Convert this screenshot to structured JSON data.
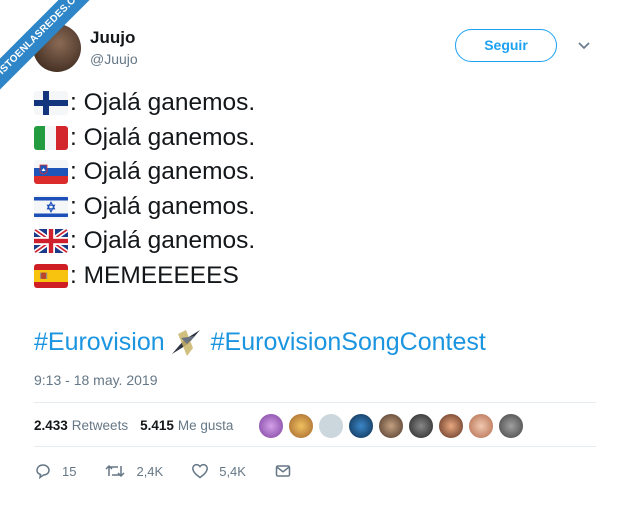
{
  "watermark": "VISTOENLASREDES.COM",
  "user": {
    "name": "Juujo",
    "handle": "@Juujo"
  },
  "follow_label": "Seguir",
  "lines": [
    {
      "flag": "finland",
      "text": ": Ojalá ganemos."
    },
    {
      "flag": "italy",
      "text": ": Ojalá ganemos."
    },
    {
      "flag": "slovenia",
      "text": ": Ojalá ganemos."
    },
    {
      "flag": "israel",
      "text": ": Ojalá ganemos."
    },
    {
      "flag": "united-kingdom",
      "text": ": Ojalá ganemos."
    },
    {
      "flag": "spain",
      "text": ": MEMEEEEES"
    }
  ],
  "hashtags": [
    "#Eurovision",
    "#EurovisionSongContest"
  ],
  "timestamp": "9:13 - 18 may. 2019",
  "stats": {
    "retweets_count": "2.433",
    "retweets_label": "Retweets",
    "likes_count": "5.415",
    "likes_label": "Me gusta"
  },
  "actions": {
    "replies": "15",
    "retweets": "2,4K",
    "likes": "5,4K"
  },
  "colors": {
    "accent": "#1da1f2",
    "link": "#1b95e0",
    "muted": "#657786",
    "retweet": "#17bf63",
    "watermark": "#2e86c8"
  }
}
